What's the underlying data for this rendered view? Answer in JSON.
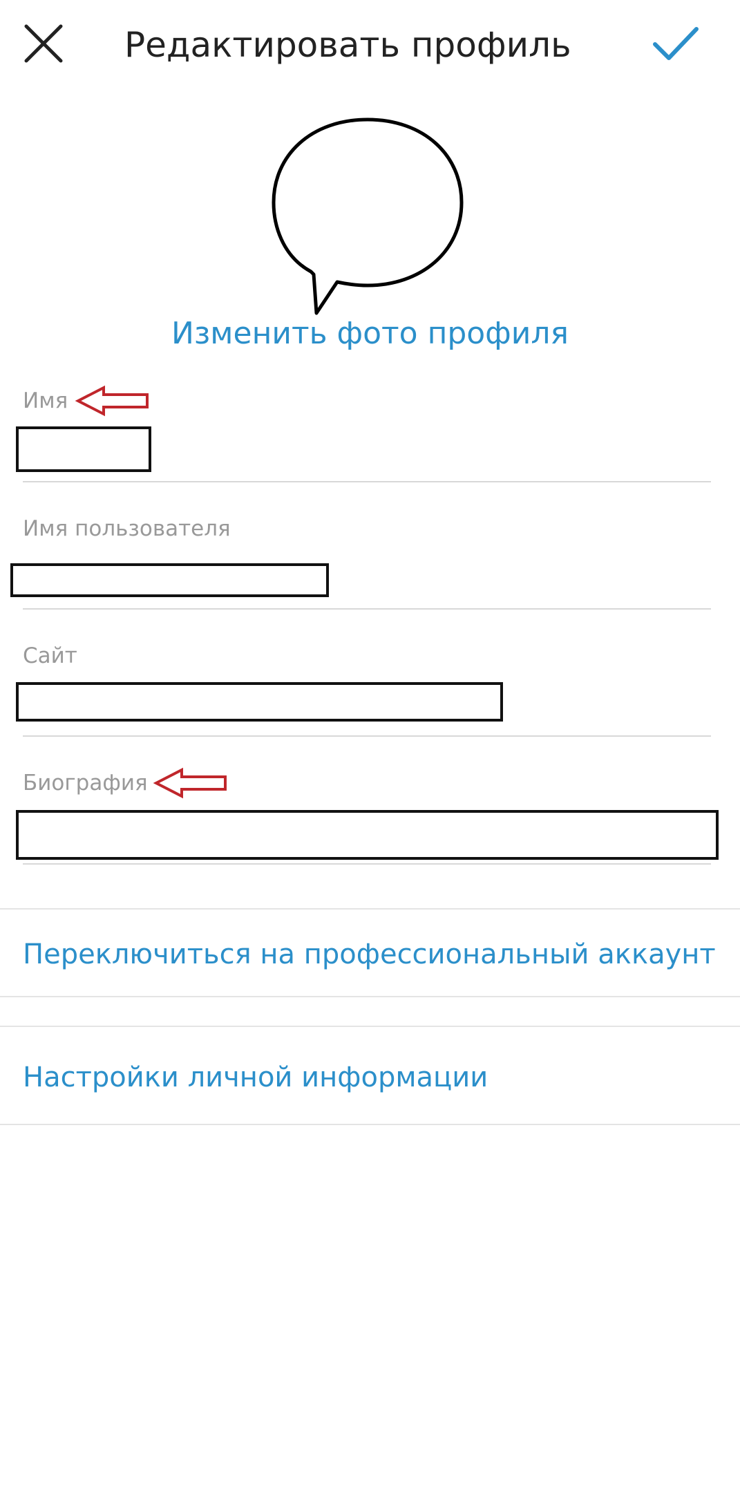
{
  "colors": {
    "accent": "#2b8fca",
    "arrow": "#c0262b",
    "text": "#222222",
    "label": "#999999"
  },
  "header": {
    "close_icon": "close-icon",
    "title": "Редактировать профиль",
    "save_icon": "checkmark-icon"
  },
  "profile_photo": {
    "icon": "speech-bubble-icon",
    "change_label": "Изменить фото профиля"
  },
  "fields": [
    {
      "label": "Имя",
      "value": ""
    },
    {
      "label": "Имя пользователя",
      "value": ""
    },
    {
      "label": "Сайт",
      "value": ""
    },
    {
      "label": "Биография",
      "value": ""
    }
  ],
  "annotations": {
    "arrow_icon": "left-arrow-icon"
  },
  "links": {
    "professional": "Переключиться на профессиональный аккаунт",
    "personal_info": "Настройки личной информации"
  }
}
